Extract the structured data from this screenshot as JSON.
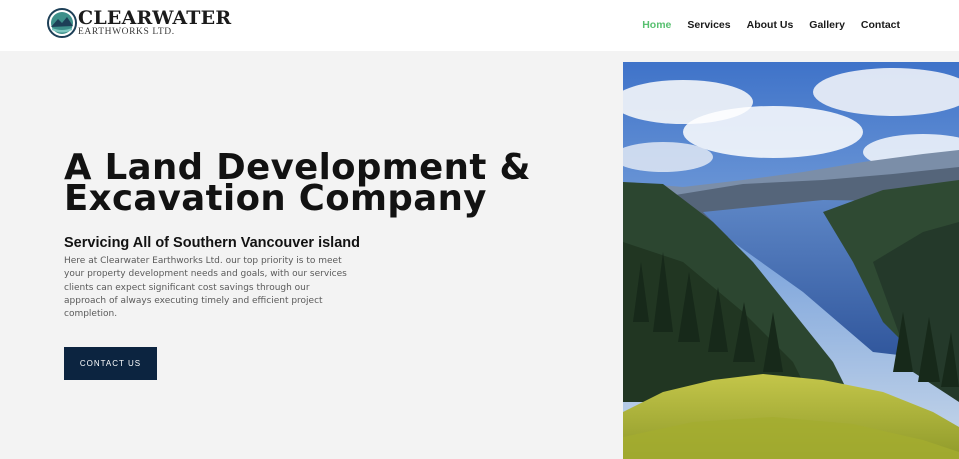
{
  "header": {
    "logo": {
      "brand": "CLEARWATER",
      "sub": "EARTHWORKS LTD."
    },
    "nav": [
      {
        "label": "Home",
        "active": true
      },
      {
        "label": "Services",
        "active": false
      },
      {
        "label": "About Us",
        "active": false
      },
      {
        "label": "Gallery",
        "active": false
      },
      {
        "label": "Contact",
        "active": false
      }
    ]
  },
  "hero": {
    "title_line1": "A Land Development &",
    "title_line2": "Excavation Company",
    "subtitle": "Servicing All of Southern Vancouver island",
    "body": "Here at Clearwater Earthworks Ltd. our top priority is to meet your property development needs and goals, with our services clients can expect significant cost savings through our approach of always executing timely and efficient project completion.",
    "cta_label": "CONTACT US"
  },
  "colors": {
    "nav_active": "#58c070",
    "cta_bg": "#0c2440",
    "page_bg": "#f3f3f3"
  }
}
